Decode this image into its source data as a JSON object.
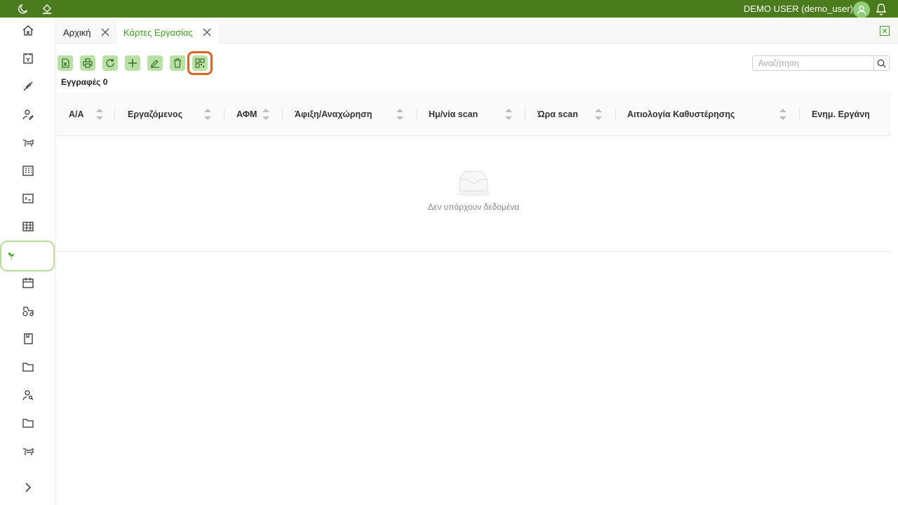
{
  "topbar": {
    "user_label": "DEMO USER (demo_user)",
    "bg_color": "#4a7b1c",
    "icons": [
      "moon-icon",
      "paint-bucket-icon",
      "user-avatar-icon",
      "bell-icon"
    ]
  },
  "sidebar": {
    "items": [
      {
        "icon": "home-icon"
      },
      {
        "icon": "invoice-icon"
      },
      {
        "icon": "wheat-icon"
      },
      {
        "icon": "user-edit-icon"
      },
      {
        "icon": "cow-icon"
      },
      {
        "icon": "building-icon"
      },
      {
        "icon": "terminal-icon"
      },
      {
        "icon": "table-icon"
      },
      {
        "icon": "plant-icon",
        "active": true
      },
      {
        "icon": "calendar-icon"
      },
      {
        "icon": "tractor-icon"
      },
      {
        "icon": "book-icon"
      },
      {
        "icon": "folder-icon"
      },
      {
        "icon": "user-search-icon"
      },
      {
        "icon": "folder-icon"
      },
      {
        "icon": "cow-icon"
      }
    ],
    "expand_icon": "chevron-right-icon"
  },
  "tabs": [
    {
      "label": "Αρχική",
      "active": false
    },
    {
      "label": "Κάρτες Εργασίας",
      "active": true
    }
  ],
  "toolbar": {
    "buttons": [
      "excel-icon",
      "print-icon",
      "refresh-icon",
      "plus-icon",
      "edit-icon",
      "trash-icon",
      "qr-code-icon"
    ]
  },
  "records_label": "Εγγραφές 0",
  "search": {
    "placeholder": "Αναζήτηση"
  },
  "table": {
    "columns": [
      "Α/Α",
      "Εργαζόμενος",
      "ΑΦΜ",
      "Άφιξη/Αναχώρηση",
      "Ημ/νία scan",
      "Ώρα scan",
      "Αιτιολογία Καθυστέρησης",
      "Ενημ. Εργάνη"
    ],
    "rows": [],
    "empty_text": "Δεν υπάρχουν δεδομένα"
  },
  "colors": {
    "accent": "#3aa51c",
    "button_bg": "#b7e2a4",
    "focus": "#e0641e"
  }
}
